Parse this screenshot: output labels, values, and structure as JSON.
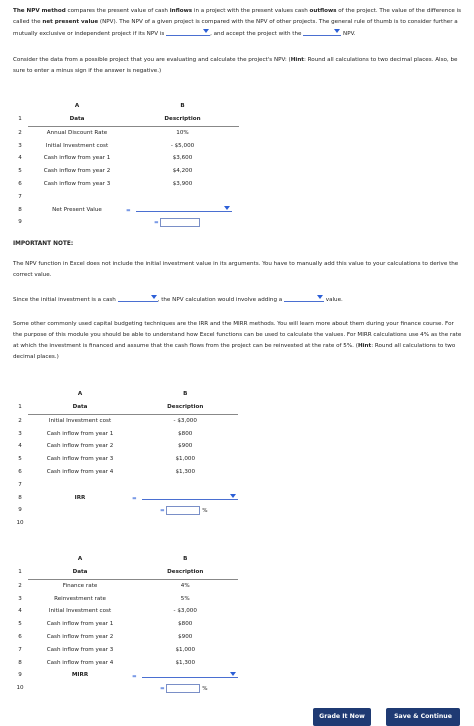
{
  "intro": {
    "p1_part1": "The NPV method",
    "p1_part2": " compares the present value of cash ",
    "p1_inflows": "inflows",
    "p1_part3": " in a project with the present values cash ",
    "p1_outflows": "outflows",
    "p1_part4": " of the project. The value of the difference is called the ",
    "p1_npv": "net present value",
    "p1_part5": " (NPV). The NPV of a given project is compared with the NPV of other projects. The general rule of thumb is to consider further a mutually exclusive or independent project if its NPV is",
    "p1_part6": ", and accept the project with the",
    "p1_part7": "NPV.",
    "p2_part1": "Consider the data from a possible project that you are evaluating and calculate the project's NPV: (",
    "p2_hint": "Hint",
    "p2_part2": ": Round all calculations to two decimal places. Also, be sure to enter a minus sign if the answer is negative.)"
  },
  "table1": {
    "col_a": "A",
    "col_b": "B",
    "rows": [
      {
        "n": "1",
        "a": "Data",
        "b": "Description"
      },
      {
        "n": "2",
        "a": "Annual Discount Rate",
        "b": "10%"
      },
      {
        "n": "3",
        "a": "Initial Investment cost",
        "b": "- $5,000"
      },
      {
        "n": "4",
        "a": "Cash inflow from year 1",
        "b": "$3,600"
      },
      {
        "n": "5",
        "a": "Cash inflow from year 2",
        "b": "$4,200"
      },
      {
        "n": "6",
        "a": "Cash inflow from year 3",
        "b": "$3,900"
      },
      {
        "n": "7",
        "a": "",
        "b": ""
      },
      {
        "n": "8",
        "a": "Net Present Value",
        "b": ""
      },
      {
        "n": "9",
        "a": "",
        "b": ""
      }
    ],
    "eq": "="
  },
  "important": {
    "heading": "IMPORTANT NOTE:",
    "text": "The NPV function in Excel does not include the initial investment value in its arguments. You have to manually add this value to your calculations to derive the correct value.",
    "since_part1": "Since the initial investment is a cash",
    "since_part2": ", the NPV calculation would involve adding a",
    "since_part3": "value."
  },
  "other": {
    "text1": "Some other commonly used capital budgeting techniques are the IRR and the MIRR methods. You will learn more about them during your finance course. For the purpose of this module you should be able to understand how Excel functions can be used to calculate the values. For MIRR calculations use 4% as the rate at which the investment is financed and assume that the cash flows from the project can be reinvested at the rate of 5%. (",
    "hint": "Hint",
    "text2": ": Round all calculations to two decimal places.)"
  },
  "table2": {
    "col_a": "A",
    "col_b": "B",
    "rows": [
      {
        "n": "1",
        "a": "Data",
        "b": "Description"
      },
      {
        "n": "2",
        "a": "Initial Investment cost",
        "b": "- $3,000"
      },
      {
        "n": "3",
        "a": "Cash inflow from year 1",
        "b": "$800"
      },
      {
        "n": "4",
        "a": "Cash inflow from year 2",
        "b": "$900"
      },
      {
        "n": "5",
        "a": "Cash inflow from year 3",
        "b": "$1,000"
      },
      {
        "n": "6",
        "a": "Cash inflow from year 4",
        "b": "$1,300"
      },
      {
        "n": "7",
        "a": "",
        "b": ""
      },
      {
        "n": "8",
        "a": "IRR",
        "b": ""
      },
      {
        "n": "9",
        "a": "",
        "b": ""
      },
      {
        "n": "10",
        "a": "",
        "b": ""
      }
    ],
    "eq": "=",
    "pct": "%"
  },
  "table3": {
    "col_a": "A",
    "col_b": "B",
    "rows": [
      {
        "n": "1",
        "a": "Data",
        "b": "Description"
      },
      {
        "n": "2",
        "a": "Finance rate",
        "b": "4%"
      },
      {
        "n": "3",
        "a": "Reinvestment rate",
        "b": "5%"
      },
      {
        "n": "4",
        "a": "Initial Investment cost",
        "b": "- $3,000"
      },
      {
        "n": "5",
        "a": "Cash inflow from year 1",
        "b": "$800"
      },
      {
        "n": "6",
        "a": "Cash inflow from year 2",
        "b": "$900"
      },
      {
        "n": "7",
        "a": "Cash inflow from year 3",
        "b": "$1,000"
      },
      {
        "n": "8",
        "a": "Cash inflow from year 4",
        "b": "$1,300"
      },
      {
        "n": "9",
        "a": "MIRR",
        "b": ""
      },
      {
        "n": "10",
        "a": "",
        "b": ""
      }
    ],
    "eq": "=",
    "pct": "%"
  },
  "buttons": {
    "grade": "Grade It Now",
    "save": "Save & Continue"
  }
}
